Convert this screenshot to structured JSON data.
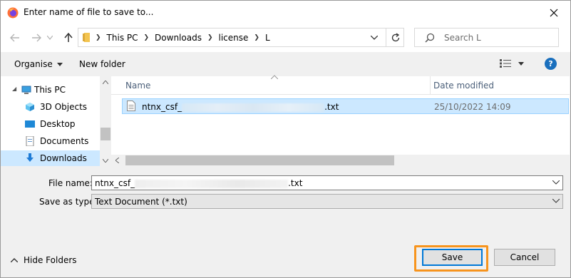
{
  "window": {
    "title": "Enter name of file to save to...",
    "close_icon": "close-icon",
    "app_icon": "firefox-icon"
  },
  "nav": {
    "breadcrumbs": [
      "This PC",
      "Downloads",
      "license",
      "L"
    ],
    "search_placeholder": "Search L"
  },
  "toolbar": {
    "organise": "Organise",
    "new_folder": "New folder",
    "help": "?"
  },
  "sidebar": {
    "items": [
      {
        "label": "This PC",
        "icon": "computer-icon"
      },
      {
        "label": "3D Objects",
        "icon": "cube-icon"
      },
      {
        "label": "Desktop",
        "icon": "desktop-icon"
      },
      {
        "label": "Documents",
        "icon": "document-icon"
      },
      {
        "label": "Downloads",
        "icon": "download-icon",
        "selected": true
      }
    ]
  },
  "file_list": {
    "columns": [
      "Name",
      "Date modified"
    ],
    "rows": [
      {
        "name_prefix": "ntnx_csf_",
        "name_suffix": ".txt",
        "date": "25/10/2022 14:09"
      }
    ]
  },
  "form": {
    "file_name_label": "File name:",
    "file_name_prefix": "ntnx_csf_",
    "file_name_suffix": ".txt",
    "save_type_label": "Save as type:",
    "save_type_value": "Text Document (*.txt)"
  },
  "footer": {
    "hide_folders": "Hide Folders",
    "save": "Save",
    "cancel": "Cancel"
  },
  "colors": {
    "accent": "#0078d7",
    "highlight": "#f7941d",
    "selection": "#cce8ff"
  }
}
